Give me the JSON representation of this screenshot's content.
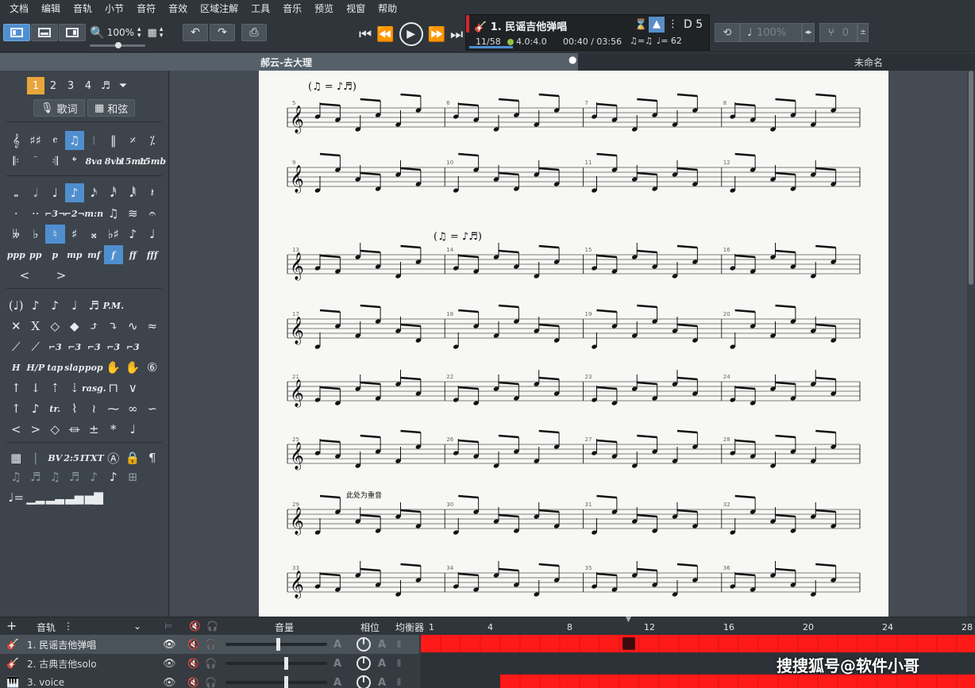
{
  "menu": [
    "文档",
    "编辑",
    "音轨",
    "小节",
    "音符",
    "音效",
    "区域注解",
    "工具",
    "音乐",
    "预览",
    "视窗",
    "帮助"
  ],
  "toolbar": {
    "zoom": "100%",
    "undo_icon": "undo-icon",
    "redo_icon": "redo-icon",
    "print_icon": "print-icon"
  },
  "lcd": {
    "track_title": "1. 民谣吉他弹唱",
    "bar_position": "11/58",
    "time_signature": "4.0:4.0",
    "time": "00:40 / 03:56",
    "swing": "♫=♫",
    "tempo": "♩= 62",
    "key": "D 5",
    "progress_fraction": 0.19
  },
  "right_tools": {
    "speed": "100%",
    "value": "0"
  },
  "tabs": {
    "active": "郝云-去大理",
    "other": "未命名"
  },
  "palette": {
    "voice_tabs": [
      "1",
      "2",
      "3",
      "4"
    ],
    "lyrics_btn": "歌词",
    "chords_btn": "和弦",
    "dynamics": [
      "ppp",
      "pp",
      "p",
      "mp",
      "mf",
      "f",
      "ff",
      "fff"
    ],
    "techniques": [
      "tap",
      "slap",
      "pop",
      "rasg."
    ],
    "misc": [
      "BV",
      "2:51",
      "TXT"
    ]
  },
  "score": {
    "tempo_marks": [
      "(♫ = ♪♬)",
      "(♫ = ♪♬)"
    ],
    "annotation": "此处为重音",
    "bar_numbers": [
      5,
      6,
      7,
      8,
      9,
      10,
      11,
      12,
      13,
      14,
      15,
      16,
      17,
      18,
      19,
      20,
      21,
      22,
      23,
      24,
      25,
      26,
      27,
      28,
      29,
      30,
      31,
      32,
      33,
      34,
      35,
      36
    ]
  },
  "tracks": {
    "header": {
      "add": "+",
      "label": "音轨",
      "volume": "音量",
      "pan": "相位",
      "eq": "均衡器"
    },
    "items": [
      {
        "name": "1. 民谣吉他弹唱"
      },
      {
        "name": "2. 古典吉他solo"
      },
      {
        "name": "3. voice"
      }
    ],
    "ruler": [
      "1",
      "4",
      "8",
      "12",
      "16",
      "20",
      "24",
      "28"
    ]
  },
  "watermark": "搜搜狐号@软件小哥"
}
